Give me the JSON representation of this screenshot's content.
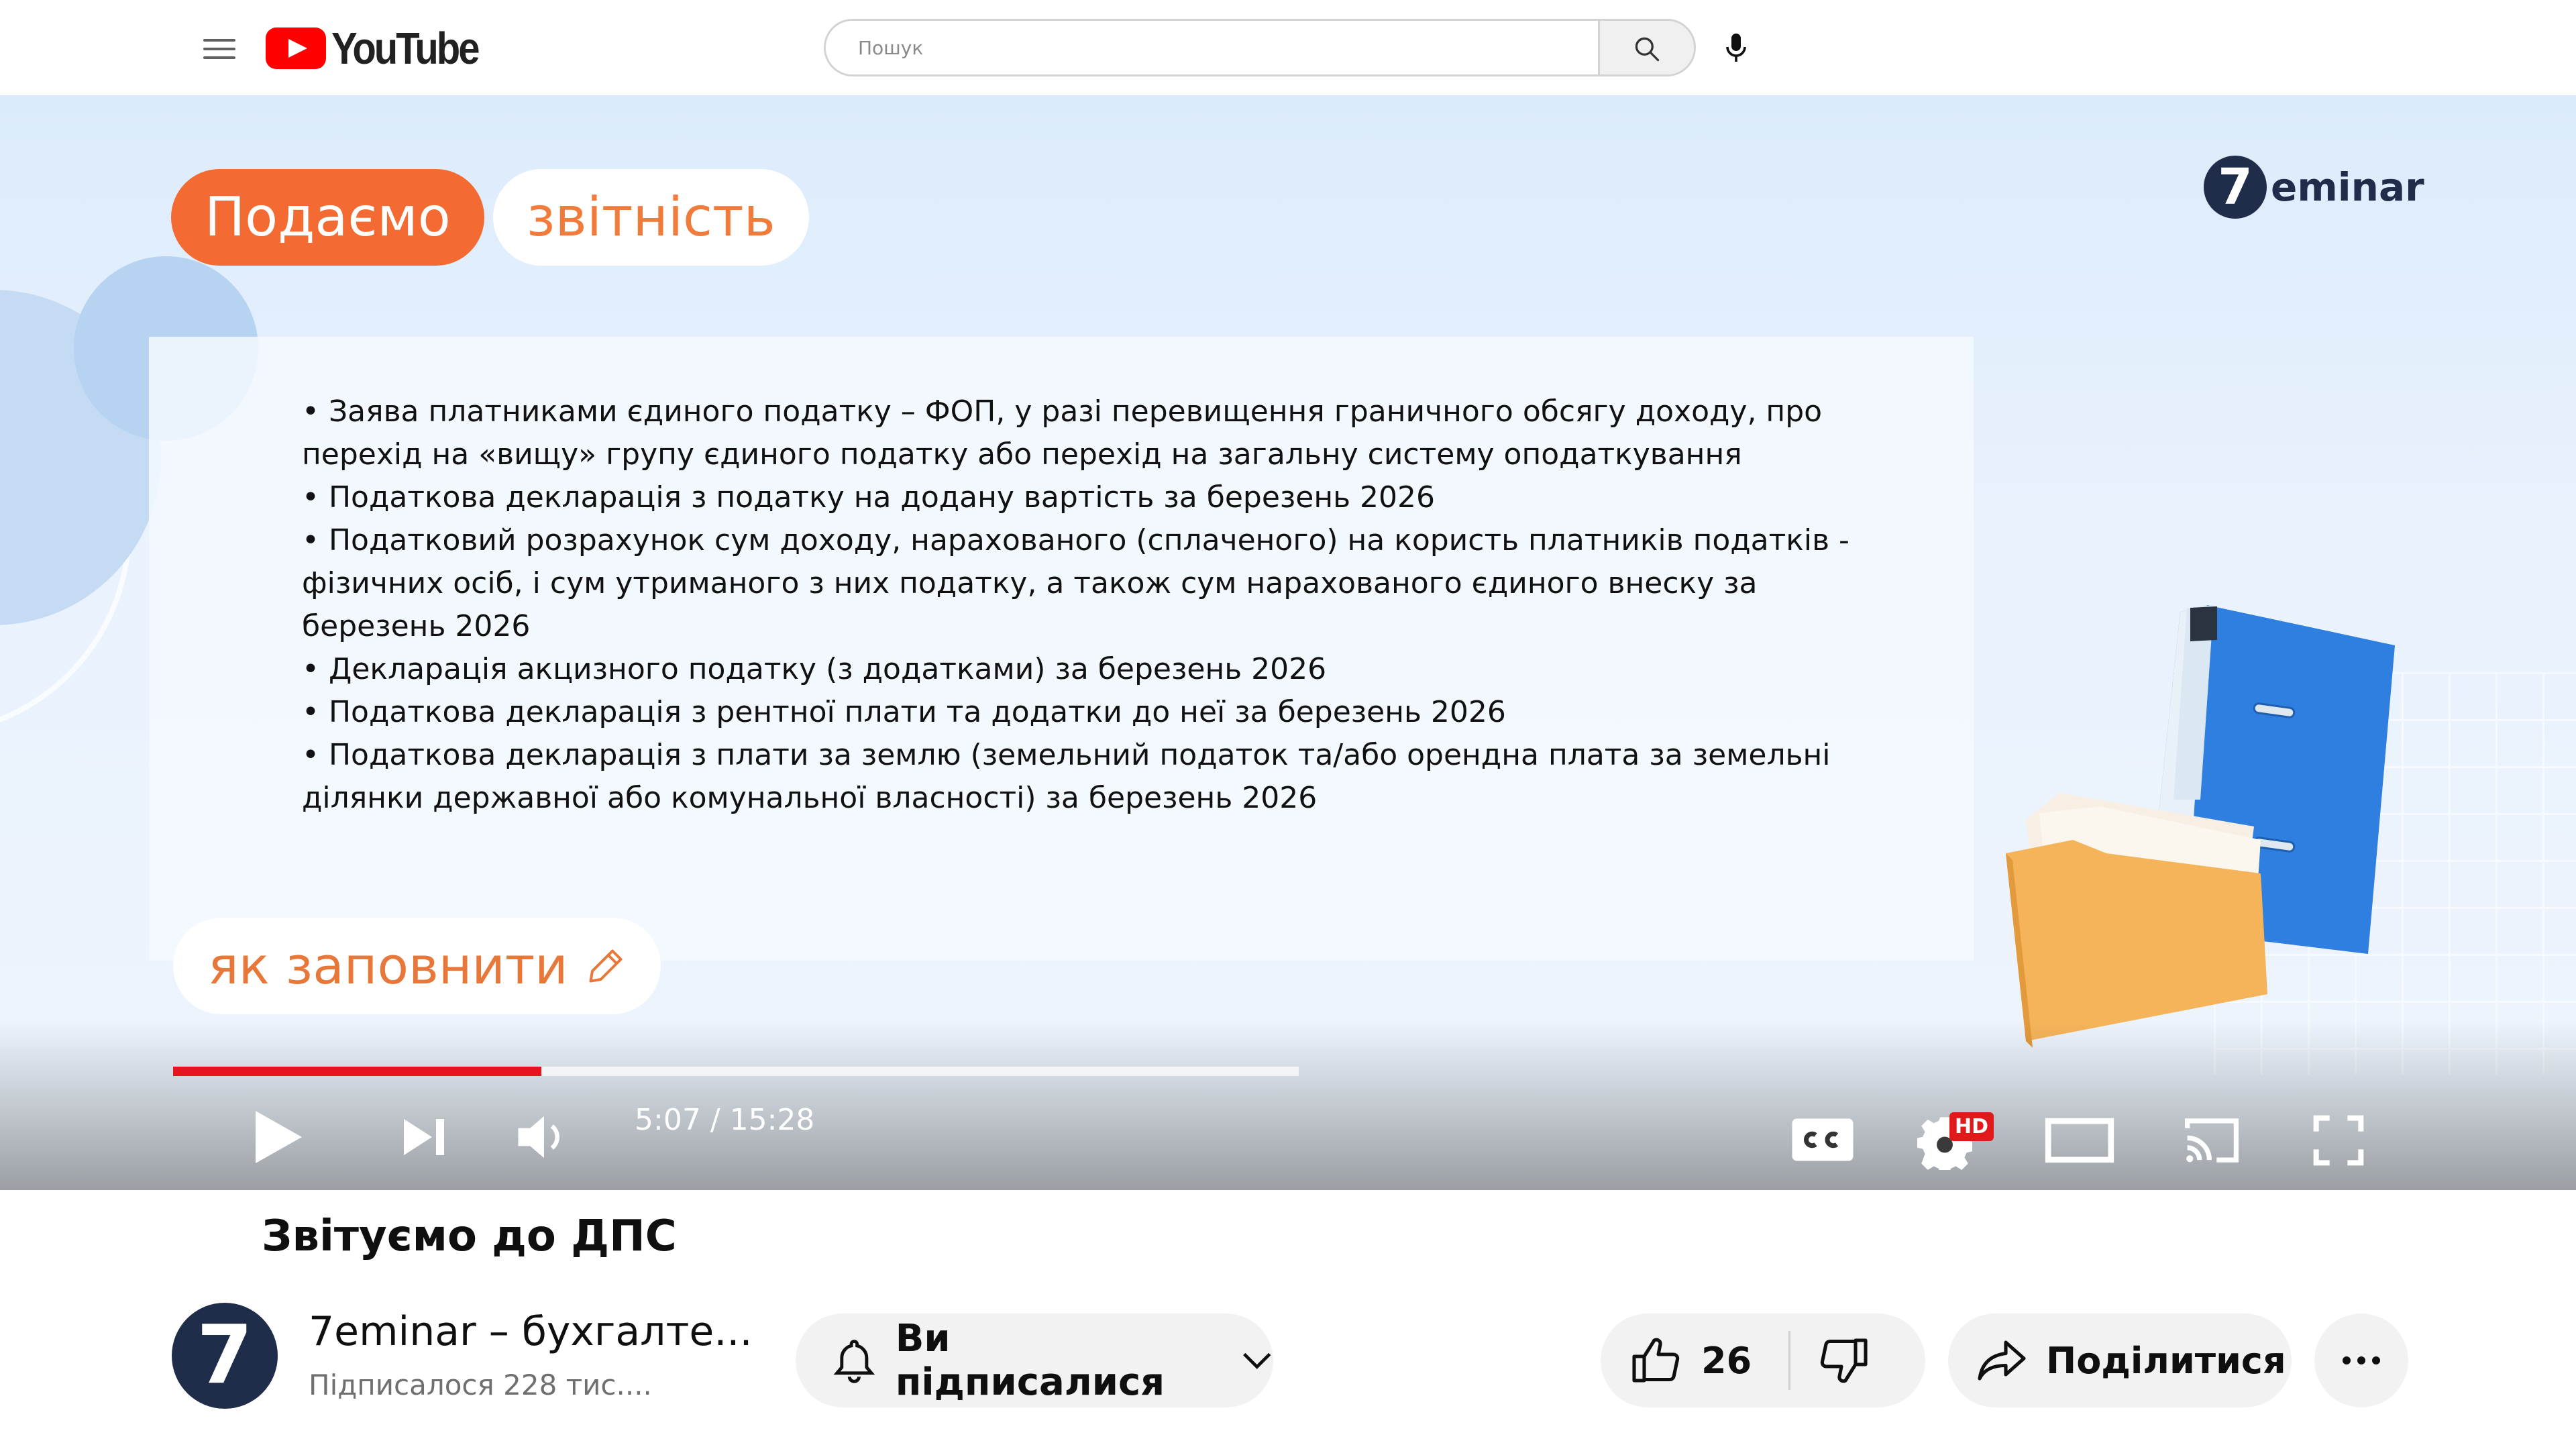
{
  "header": {
    "logo_text": "YouTube",
    "search_placeholder": "Пошук",
    "icons": [
      "menu-icon",
      "youtube-logo-icon",
      "search-icon",
      "microphone-icon"
    ]
  },
  "video": {
    "tags": {
      "primary": "Подаємо",
      "secondary": "звітність"
    },
    "brand": {
      "badge": "7",
      "text": "eminar"
    },
    "bullets": [
      "• Заява платниками єдиного податку – ФОП, у разі перевищення граничного обсягу доходу, про",
      "перехід на «вищу» групу єдиного податку або перехід на загальну систему оподаткування",
      "• Податкова декларація з податку на додану вартість за березень 2026",
      "• Податковий розрахунок сум доходу, нарахованого (сплаченого) на користь платників податків -",
      "фізичних осіб, і сум утриманого з них податку, а також сум нарахованого єдиного внеску за",
      "березень 2026",
      "• Декларація акцизного податку (з додатками) за березень 2026",
      "• Податкова декларація з рентної плати та додатки до неї за березень 2026",
      "• Податкова декларація з плати за землю (земельний податок та/або орендна плата за земельні",
      "ділянки державної або комунальної власності) за березень 2026"
    ],
    "fill_label": "як заповнити",
    "player": {
      "time": "5:07 / 15:28",
      "progress_fraction": 0.327,
      "hd_badge": "HD",
      "accent_color": "#e5141f"
    }
  },
  "info": {
    "title": "Звітуємо до ДПС",
    "channel": {
      "avatar_text": "7",
      "name": "7eminar – бухгалте...",
      "subscribers": "Підписалося 228 тис...."
    },
    "subscribe_label": "Ви підписалися",
    "likes": "26",
    "share_label": "Поділитися"
  }
}
